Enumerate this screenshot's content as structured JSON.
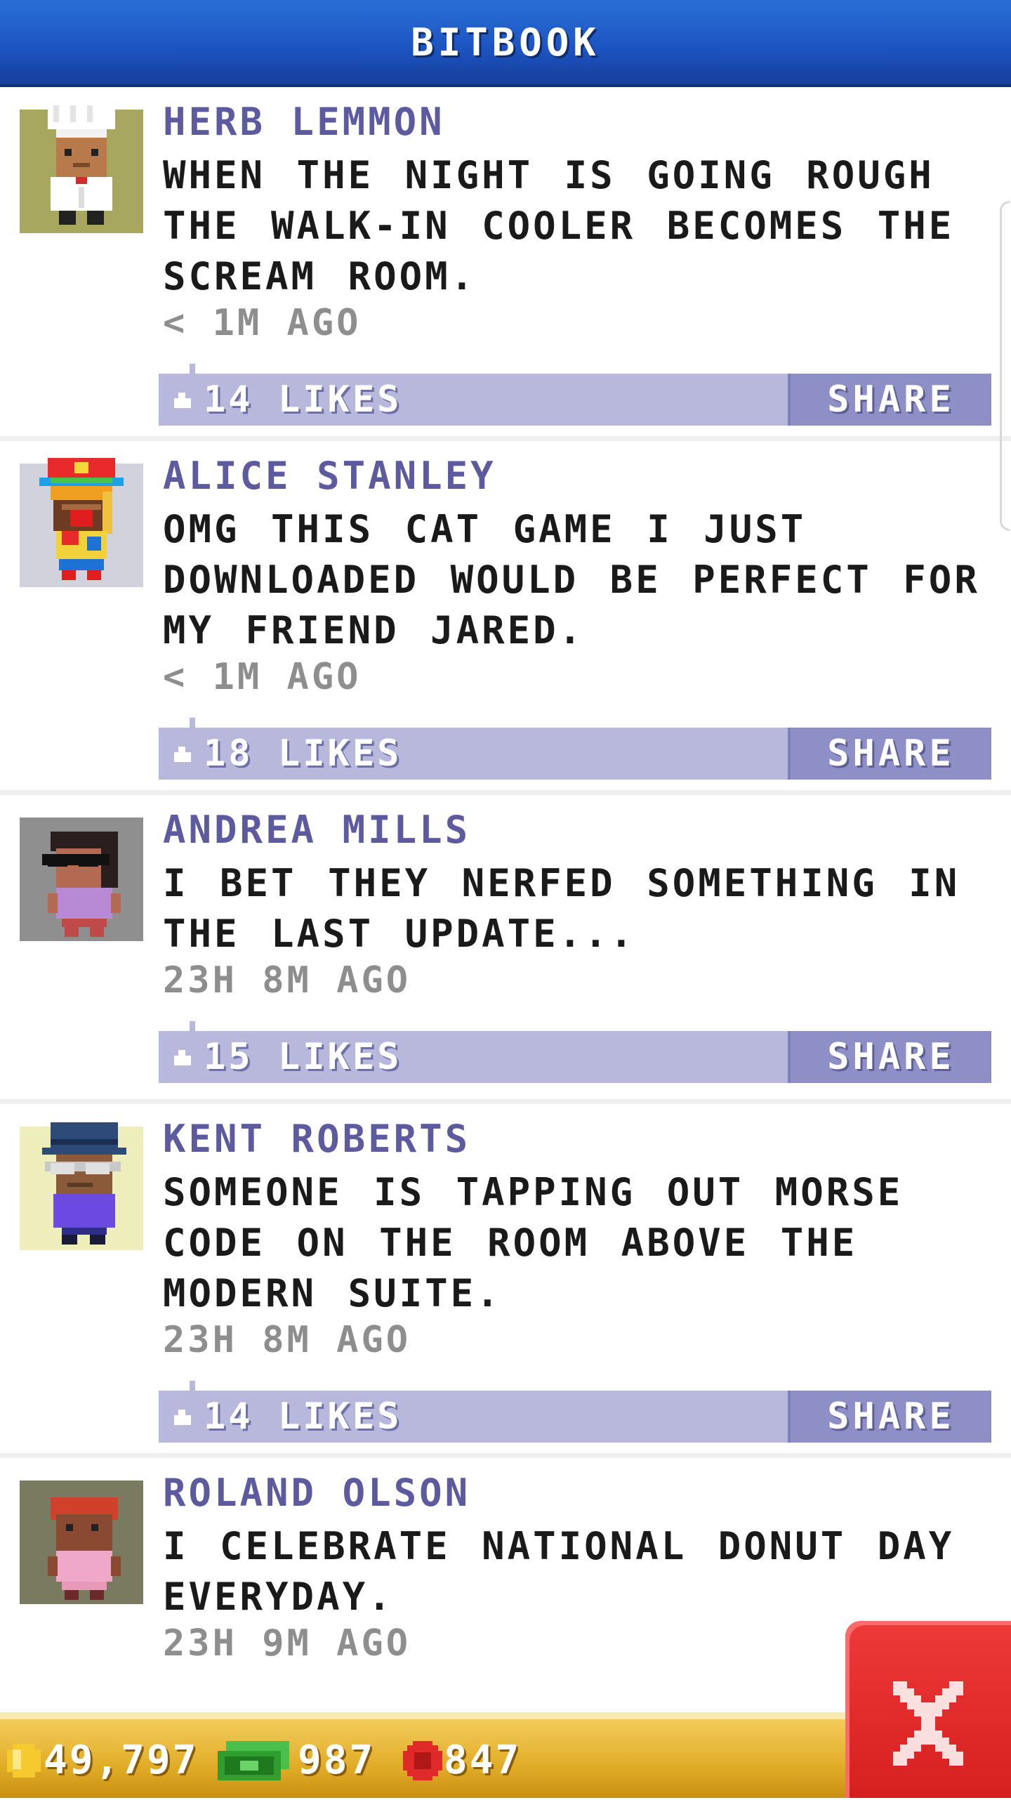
{
  "header": {
    "title": "BITBOOK"
  },
  "posts": [
    {
      "name": "HERB LEMMON",
      "text": "WHEN THE NIGHT IS GOING ROUGH THE WALK-IN COOLER BECOMES THE SCREAM ROOM.",
      "time": "< 1M AGO",
      "likes": "14 LIKES",
      "share": "SHARE",
      "avatar_bg": "#a7a760"
    },
    {
      "name": "ALICE STANLEY",
      "text": "OMG THIS CAT GAME I JUST DOWNLOADED WOULD BE PERFECT FOR MY FRIEND JARED.",
      "time": "< 1M AGO",
      "likes": "18 LIKES",
      "share": "SHARE",
      "avatar_bg": "#d2d2dc"
    },
    {
      "name": "ANDREA MILLS",
      "text": "I BET THEY NERFED SOMETHING IN THE LAST UPDATE...",
      "time": "23H 8M AGO",
      "likes": "15 LIKES",
      "share": "SHARE",
      "avatar_bg": "#8f8f8f"
    },
    {
      "name": "KENT ROBERTS",
      "text": "SOMEONE IS TAPPING OUT MORSE CODE ON THE ROOM ABOVE THE MODERN SUITE.",
      "time": "23H 8M AGO",
      "likes": "14 LIKES",
      "share": "SHARE",
      "avatar_bg": "#eeeebc"
    },
    {
      "name": "ROLAND OLSON",
      "text": "I CELEBRATE NATIONAL DONUT DAY EVERYDAY.",
      "time": "23H 9M AGO",
      "likes": "",
      "share": "",
      "avatar_bg": "#7a7a60"
    }
  ],
  "stats": {
    "coins": "49,797",
    "bux": "987",
    "points": "847"
  },
  "colors": {
    "header": "#1d55c2",
    "name": "#5d5aa0",
    "like_bar": "#b7b8dc",
    "share_button": "#8e8fc6",
    "bottom_bar": "#e1ad28",
    "close_button": "#d61f1f"
  },
  "icons": {
    "like": "like-icon",
    "coin": "coin-icon",
    "bux": "bux-icon",
    "points": "points-icon",
    "close": "close-icon"
  }
}
